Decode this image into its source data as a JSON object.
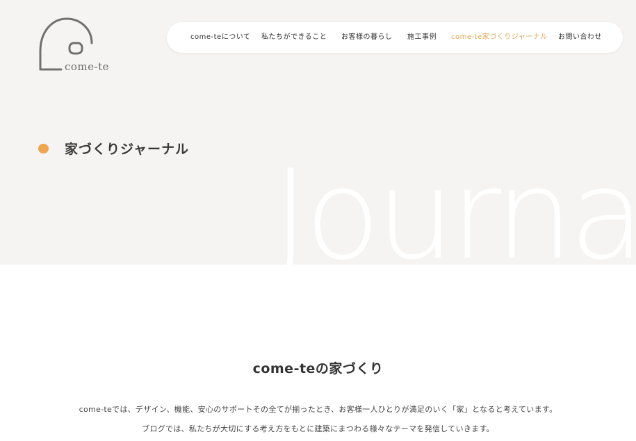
{
  "logo": {
    "text": "come-te"
  },
  "nav": {
    "items": [
      {
        "label": "come-teについて",
        "active": false
      },
      {
        "label": "私たちができること",
        "active": false
      },
      {
        "label": "お客様の暮らし",
        "active": false
      },
      {
        "label": "施工事例",
        "active": false
      },
      {
        "label": "come-te家づくりジャーナル",
        "active": true
      },
      {
        "label": "お問い合わせ",
        "active": false
      }
    ]
  },
  "hero": {
    "page_title": "家づくりジャーナル",
    "bg_word": "Journal"
  },
  "main": {
    "section_title": "come-teの家づくり",
    "paragraphs": [
      "come-teでは、デザイン、機能、安心のサポートその全てが揃ったとき、お客様一人ひとりが満足のいく「家」となると考えています。",
      "ブログでは、私たちが大切にする考え方をもとに建築にまつわる様々なテーマを発信していきます。"
    ]
  },
  "colors": {
    "accent": "#eea650",
    "nav_active": "#e0a452",
    "hero_bg": "#f5f4f2"
  }
}
